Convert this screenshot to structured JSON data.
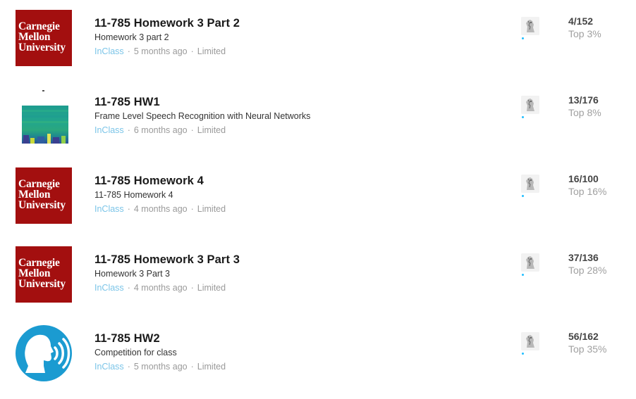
{
  "competitions": [
    {
      "thumbnail": "cmu-logo",
      "thumbnail_text": [
        "Carnegie",
        "Mellon",
        "University"
      ],
      "title": "11-785 Homework 3 Part 2",
      "subtitle": "Homework 3 part 2",
      "host": "InClass",
      "time_ago": "5 months ago",
      "access": "Limited",
      "team_icon": "horse-avatar-icon",
      "rank": "4/152",
      "percentile": "Top 3%"
    },
    {
      "thumbnail": "spectrogram-image",
      "title": "11-785 HW1",
      "subtitle": "Frame Level Speech Recognition with Neural Networks",
      "host": "InClass",
      "time_ago": "6 months ago",
      "access": "Limited",
      "team_icon": "horse-avatar-icon",
      "rank": "13/176",
      "percentile": "Top 8%"
    },
    {
      "thumbnail": "cmu-logo",
      "thumbnail_text": [
        "Carnegie",
        "Mellon",
        "University"
      ],
      "title": "11-785 Homework 4",
      "subtitle": "11-785 Homework 4",
      "host": "InClass",
      "time_ago": "4 months ago",
      "access": "Limited",
      "team_icon": "horse-avatar-icon",
      "rank": "16/100",
      "percentile": "Top 16%"
    },
    {
      "thumbnail": "cmu-logo",
      "thumbnail_text": [
        "Carnegie",
        "Mellon",
        "University"
      ],
      "title": "11-785 Homework 3 Part 3",
      "subtitle": "Homework 3 Part 3",
      "host": "InClass",
      "time_ago": "4 months ago",
      "access": "Limited",
      "team_icon": "horse-avatar-icon",
      "rank": "37/136",
      "percentile": "Top 28%"
    },
    {
      "thumbnail": "voice-recognition-icon",
      "title": "11-785 HW2",
      "subtitle": "Competition for class",
      "host": "InClass",
      "time_ago": "5 months ago",
      "access": "Limited",
      "team_icon": "horse-avatar-icon",
      "rank": "56/162",
      "percentile": "Top 35%"
    }
  ],
  "colors": {
    "cmu_red": "#a30f0f",
    "inclass_blue": "#7cc5e8",
    "voice_blue": "#1b9bd1",
    "team_dot": "#20beff"
  },
  "meta_separator": "·"
}
